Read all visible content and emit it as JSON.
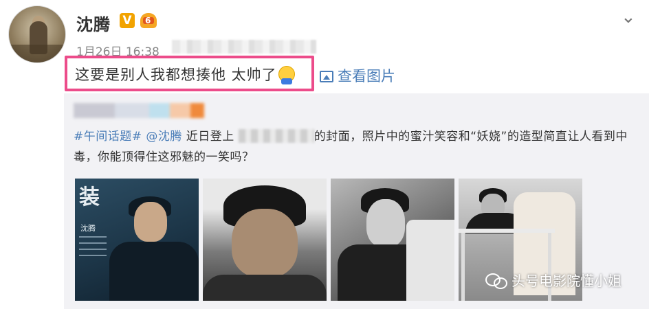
{
  "post": {
    "username": "沈腾",
    "verified_badge": "V",
    "level_badge": "6",
    "timestamp": "1月26日 16:38",
    "text": "这要是别人我都想揍他 太帅了",
    "emoji_icon": "hug-emoji-icon",
    "view_pictures_label": "查看图片",
    "highlight_color": "#ec4c8a"
  },
  "repost": {
    "topic": "#午间话题#",
    "mention": "@沈腾",
    "text_part1": " 近日登上",
    "text_part2": "的封面，照片中的蜜汁笑容和“妖娆”的造型简直让人看到中毒，你能顶得住这邪魅的一笑吗？",
    "magazine_cover": {
      "title": "装",
      "name": "沈腾"
    }
  },
  "watermark": {
    "text": "头号电影院懂小姐"
  }
}
